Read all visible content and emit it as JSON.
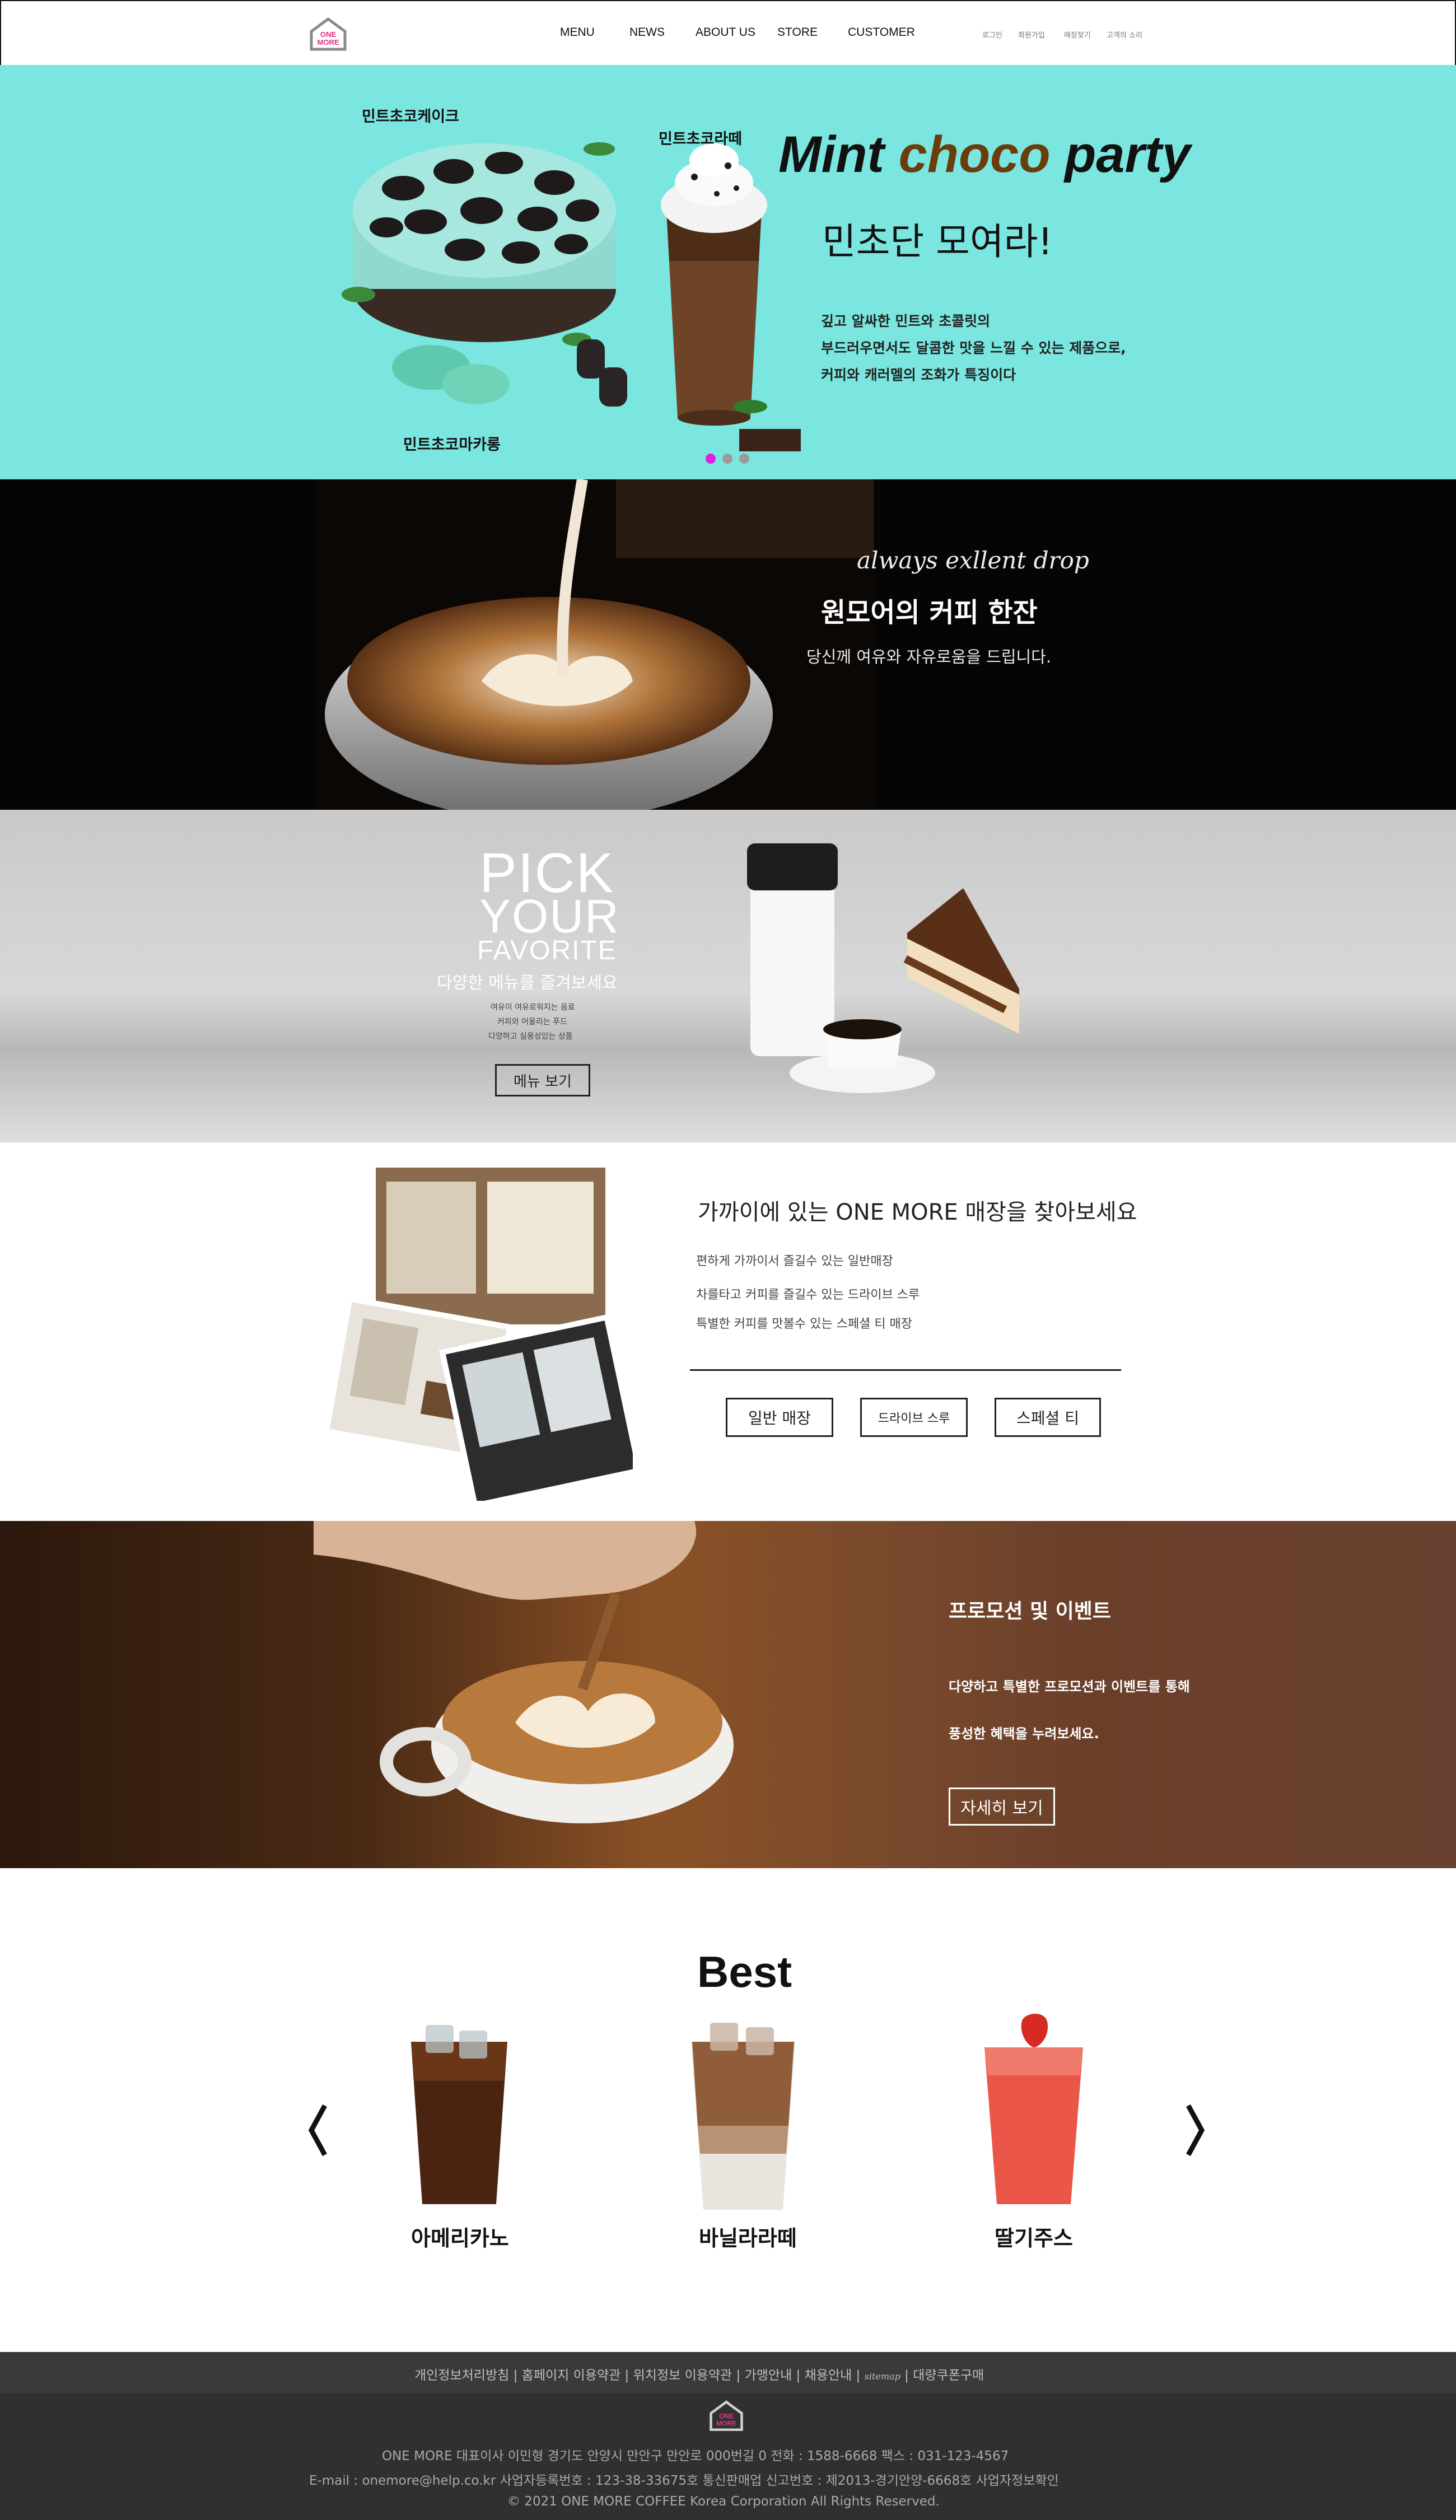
{
  "header": {
    "logo_text": [
      "ONE",
      "MORE"
    ],
    "nav": [
      "MENU",
      "NEWS",
      "ABOUT US",
      "STORE",
      "CUSTOMER"
    ],
    "util": [
      "로그인",
      "회원가입",
      "매장찾기",
      "고객의 소리"
    ]
  },
  "hero": {
    "title_words": [
      "Mint",
      "choco",
      "party"
    ],
    "subtitle": "민초단 모여라!",
    "lines": [
      "깊고 알싸한 민트와 초콜릿의",
      "부드러우면서도 달콤한 맛을 느낄 수 있는 제품으로,",
      "커피와 캐러멜의 조화가 특징이다"
    ],
    "labels": {
      "cake": "민트초코케이크",
      "latte": "민트초코라떼",
      "macaron": "민트초코마카롱"
    },
    "active_slide": 1,
    "slide_count": 3
  },
  "coffee_banner": {
    "script": "always exllent drop",
    "title": "원모어의 커피 한잔",
    "text": "당신께 여유와 자유로움을 드립니다."
  },
  "pick": {
    "big": [
      "PICK",
      "YOUR",
      "FAVORITE"
    ],
    "desc": "다양한 메뉴를 즐겨보세요",
    "small": [
      "여유이 여유로워지는 음료",
      "커피와 어울리는 푸드",
      "다양하고 실용성있는 상품"
    ],
    "button": "메뉴 보기"
  },
  "store": {
    "title": "가까이에 있는 ONE MORE 매장을 찾아보세요",
    "lines": [
      "편하게 가까이서 즐길수 있는 일반매장",
      "차를타고 커피를 즐길수 있는 드라이브 스루",
      "특별한 커피를 맛볼수 있는 스페셜 티 매장"
    ],
    "buttons": [
      "일반 매장",
      "드라이브 스루",
      "스페셜 티"
    ]
  },
  "promo": {
    "title": "프로모션 및 이벤트",
    "lines": [
      "다양하고 특별한 프로모션과 이벤트를 통해",
      "풍성한 혜택을 누려보세요."
    ],
    "button": "자세히 보기"
  },
  "best": {
    "title": "Best",
    "items": [
      "아메리카노",
      "바닐라라떼",
      "딸기주스"
    ]
  },
  "footer": {
    "links": [
      "개인정보처리방침",
      "홈페이지 이용약관",
      "위치정보 이용약관",
      "가맹안내",
      "채용안내",
      "sitemap",
      "대량쿠폰구매"
    ],
    "logo_text": [
      "ONE",
      "MORE"
    ],
    "line1": "ONE MORE 대표이사 이민형 경기도 안양시 만안구 만안로 000번길 0 전화 : 1588-6668 팩스 : 031-123-4567",
    "line2": "E-mail : onemore@help.co.kr 사업자등록번호 : 123-38-33675호 통신판매업 신고번호 : 제2013-경기안양-6668호 사업자정보확인",
    "copyright": "© 2021 ONE MORE COFFEE Korea Corporation All Rights Reserved."
  },
  "colors": {
    "hero_bg": "#7ae6df",
    "choco_brown": "#6b3c0c",
    "active_dot": "#e020e0",
    "logo_pink": "#e0328a",
    "footer_bg": "#303030"
  }
}
